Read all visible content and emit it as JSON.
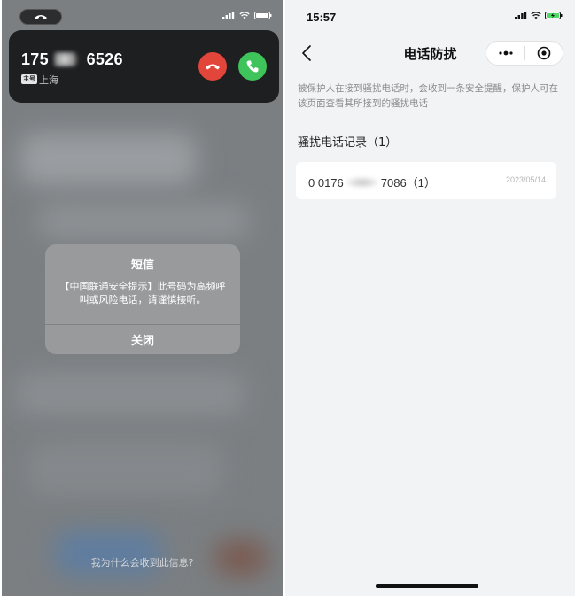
{
  "left": {
    "caller": {
      "prefix": "175",
      "suffix": "6526",
      "sim_badge": "主号",
      "location": "上海"
    },
    "alert": {
      "title": "短信",
      "body": "【中国联通安全提示】此号码为高频呼叫或风险电话，请谨慎接听。",
      "close_label": "关闭"
    },
    "why_link": "我为什么会收到此信息?"
  },
  "right": {
    "status_time": "15:57",
    "nav_title": "电话防扰",
    "description": "被保护人在接到骚扰电话时，会收到一条安全提醒，保护人可在该页面查看其所接到的骚扰电话",
    "section_title": "骚扰电话记录（1）",
    "records": [
      {
        "prefix": "0 0176",
        "suffix": "7086（1）",
        "date": "2023/05/14"
      }
    ]
  },
  "colors": {
    "decline": "#e2463b",
    "accept": "#3ec45a",
    "battery_charging": "#4cd964"
  }
}
